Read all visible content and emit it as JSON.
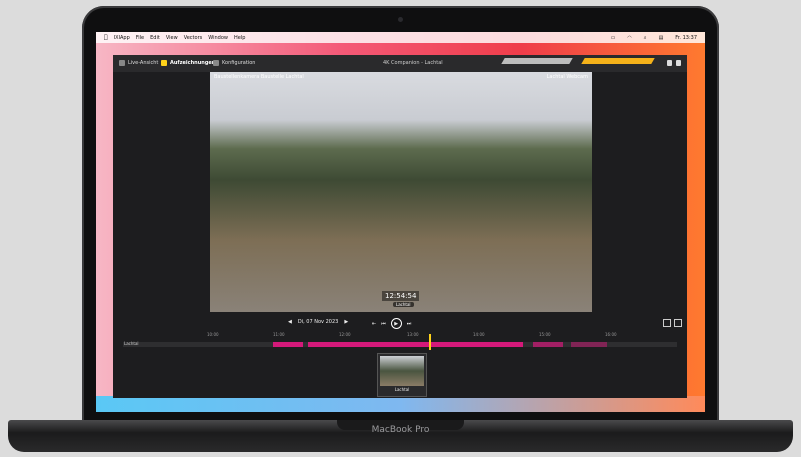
{
  "laptop_brand": "MacBook Pro",
  "menubar": {
    "apple": "",
    "items": [
      "IXIApp",
      "File",
      "Edit",
      "View",
      "Vectors",
      "Window",
      "Help"
    ],
    "clock": "Fr. 13:37"
  },
  "app": {
    "tabs": [
      "Live-Ansicht",
      "Aufzeichnungen",
      "Konfiguration"
    ],
    "window_title": "4K Companion - Lachtal"
  },
  "video": {
    "overlay_left": "Baustellenkamera Baustelle Lachtal",
    "overlay_right": "Lachtal Webcam",
    "timestamp": "12:54:54",
    "label": "Lachtal"
  },
  "playback": {
    "date": "Di, 07 Nov 2023",
    "track_label": "Lachtal",
    "ticks": [
      "10:00",
      "11:00",
      "12:00",
      "13:00",
      "14:00",
      "15:00",
      "16:00"
    ]
  },
  "thumbnail": {
    "label": "Lachtal"
  },
  "colors": {
    "accent": "#ffd21a",
    "recording": "#d4197a"
  }
}
